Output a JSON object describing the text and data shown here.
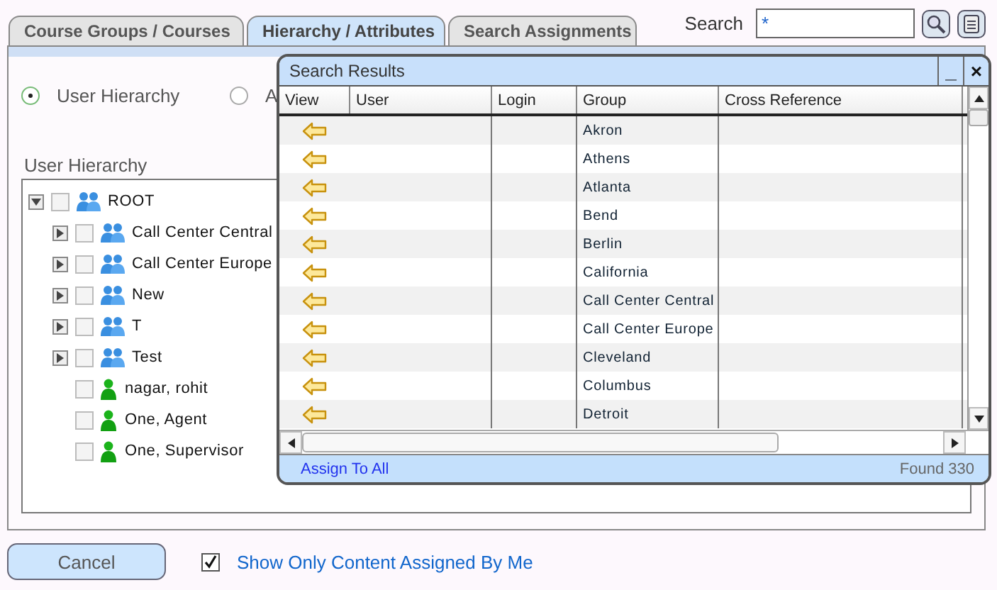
{
  "tabs": [
    {
      "label": "Course Groups / Courses",
      "selected": false
    },
    {
      "label": "Hierarchy / Attributes",
      "selected": true
    },
    {
      "label": "Search Assignments",
      "selected": false
    }
  ],
  "search": {
    "label": "Search",
    "value": "*"
  },
  "radios": [
    {
      "label": "User Hierarchy",
      "selected": true
    },
    {
      "label": "A",
      "selected": false
    }
  ],
  "hierarchy": {
    "label": "User Hierarchy",
    "tree": [
      {
        "label": "ROOT",
        "kind": "group",
        "checked": false,
        "expanded": true,
        "children": [
          {
            "label": "Call Center Central",
            "kind": "group",
            "checked": false,
            "expanded": false
          },
          {
            "label": "Call Center Europe",
            "kind": "group",
            "checked": false,
            "expanded": false
          },
          {
            "label": "New",
            "kind": "group",
            "checked": false,
            "expanded": false
          },
          {
            "label": "T",
            "kind": "group",
            "checked": false,
            "expanded": false
          },
          {
            "label": "Test",
            "kind": "group",
            "checked": false,
            "expanded": false
          },
          {
            "label": "nagar, rohit",
            "kind": "user",
            "checked": false
          },
          {
            "label": "One, Agent",
            "kind": "user",
            "checked": false
          },
          {
            "label": "One, Supervisor",
            "kind": "user",
            "checked": false
          }
        ]
      }
    ]
  },
  "results": {
    "title": "Search Results",
    "minimize": "_",
    "close": "×",
    "columns": [
      "View",
      "User",
      "Login",
      "Group",
      "Cross Reference"
    ],
    "rows": [
      {
        "group": "Akron"
      },
      {
        "group": "Athens"
      },
      {
        "group": "Atlanta"
      },
      {
        "group": "Bend"
      },
      {
        "group": "Berlin"
      },
      {
        "group": "California"
      },
      {
        "group": "Call Center Central"
      },
      {
        "group": "Call Center Europe"
      },
      {
        "group": "Cleveland"
      },
      {
        "group": "Columbus"
      },
      {
        "group": "Detroit"
      }
    ],
    "assign_all": "Assign To All",
    "found": "Found 330"
  },
  "cancel": "Cancel",
  "show_only": {
    "label": "Show Only Content Assigned By Me",
    "checked": true
  }
}
